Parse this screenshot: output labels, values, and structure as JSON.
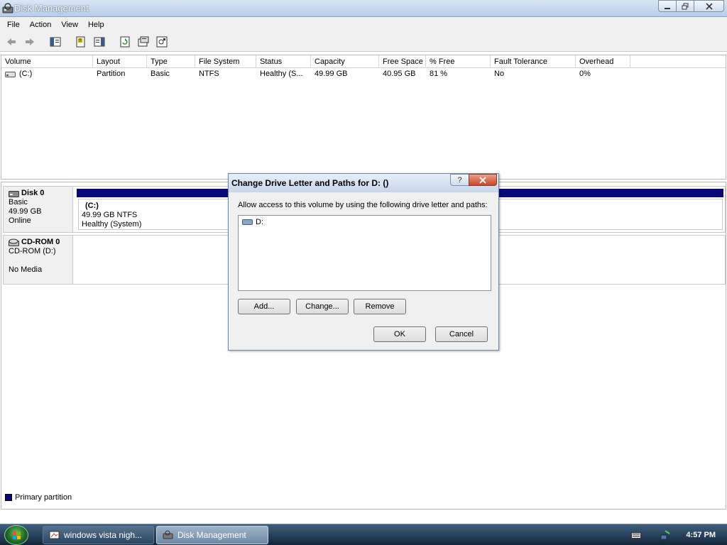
{
  "window": {
    "title": "Disk Management"
  },
  "menu": [
    "File",
    "Action",
    "View",
    "Help"
  ],
  "columns": [
    "Volume",
    "Layout",
    "Type",
    "File System",
    "Status",
    "Capacity",
    "Free Space",
    "% Free",
    "Fault Tolerance",
    "Overhead"
  ],
  "volumes": [
    {
      "volume": "(C:)",
      "layout": "Partition",
      "type": "Basic",
      "file_system": "NTFS",
      "status": "Healthy (S...",
      "capacity": "49.99 GB",
      "free_space": "40.95 GB",
      "percent_free": "81 %",
      "fault_tolerance": "No",
      "overhead": "0%"
    }
  ],
  "disks": [
    {
      "name": "Disk 0",
      "kind": "Basic",
      "size": "49.99 GB",
      "state": "Online",
      "partition": {
        "name": "(C:)",
        "size_fs": "49.99 GB NTFS",
        "status": "Healthy (System)"
      }
    },
    {
      "name": "CD-ROM 0",
      "kind": "CD-ROM (D:)",
      "size": "",
      "state": "No Media"
    }
  ],
  "legend": {
    "primary_partition": "Primary partition",
    "color": "#08087a"
  },
  "dialog": {
    "title": "Change Drive Letter and Paths for D: ()",
    "description": "Allow access to this volume by using the following drive letter and paths:",
    "paths": [
      "D:"
    ],
    "buttons": {
      "add": "Add...",
      "change": "Change...",
      "remove": "Remove",
      "ok": "OK",
      "cancel": "Cancel"
    },
    "help": "?"
  },
  "taskbar": {
    "tasks": [
      "windows vista nigh...",
      "Disk Management"
    ],
    "clock": "4:57 PM"
  }
}
